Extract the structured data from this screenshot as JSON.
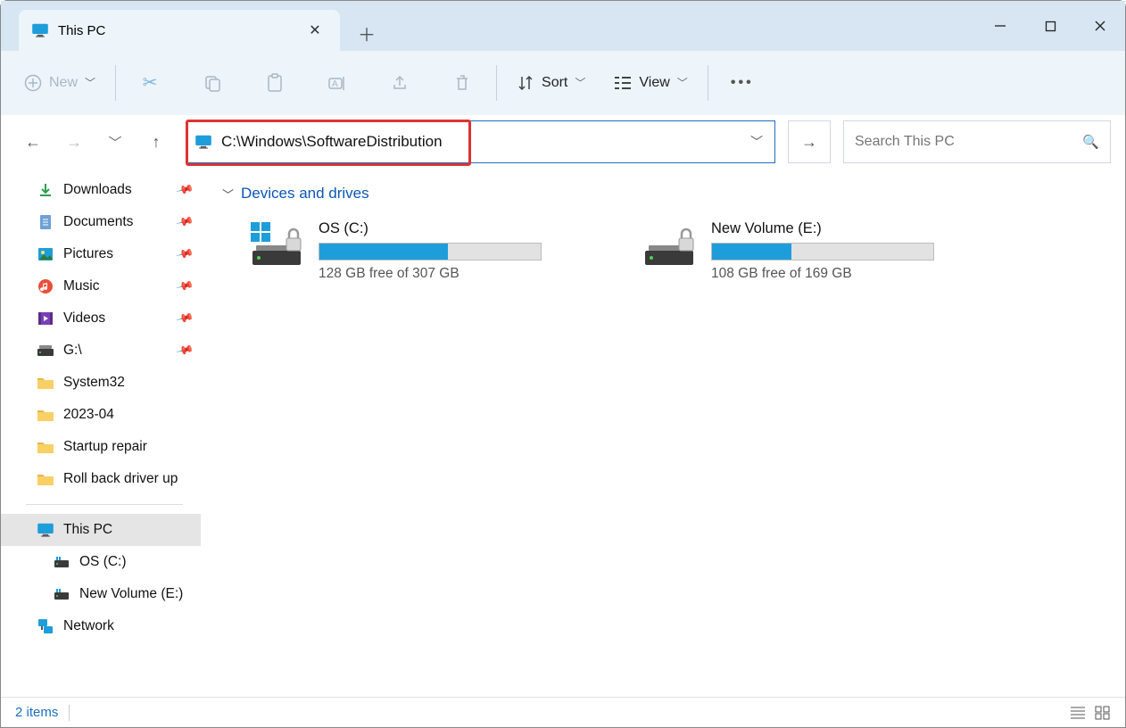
{
  "window": {
    "tab_title": "This PC",
    "new_label": "New",
    "sort_label": "Sort",
    "view_label": "View"
  },
  "address": {
    "value": "C:\\Windows\\SoftwareDistribution",
    "highlight_width": 320
  },
  "search": {
    "placeholder": "Search This PC"
  },
  "sidebar": {
    "quick": [
      {
        "label": "Downloads",
        "icon": "download",
        "pinned": true
      },
      {
        "label": "Documents",
        "icon": "document",
        "pinned": true
      },
      {
        "label": "Pictures",
        "icon": "pictures",
        "pinned": true
      },
      {
        "label": "Music",
        "icon": "music",
        "pinned": true
      },
      {
        "label": "Videos",
        "icon": "videos",
        "pinned": true
      },
      {
        "label": "G:\\",
        "icon": "drive",
        "pinned": true
      },
      {
        "label": "System32",
        "icon": "folder",
        "pinned": false
      },
      {
        "label": "2023-04",
        "icon": "folder",
        "pinned": false
      },
      {
        "label": "Startup repair",
        "icon": "folder",
        "pinned": false
      },
      {
        "label": "Roll back driver up",
        "icon": "folder",
        "pinned": false
      }
    ],
    "thispc_label": "This PC",
    "drives": [
      {
        "label": "OS (C:)"
      },
      {
        "label": "New Volume (E:)"
      }
    ],
    "network_label": "Network"
  },
  "content": {
    "group_header": "Devices and drives",
    "drives": [
      {
        "name": "OS (C:)",
        "free_text": "128 GB free of 307 GB",
        "fill_pct": 58,
        "locked": true,
        "system": true
      },
      {
        "name": "New Volume (E:)",
        "free_text": "108 GB free of 169 GB",
        "fill_pct": 36,
        "locked": true,
        "system": false
      }
    ]
  },
  "status": {
    "items_text": "2 items"
  }
}
